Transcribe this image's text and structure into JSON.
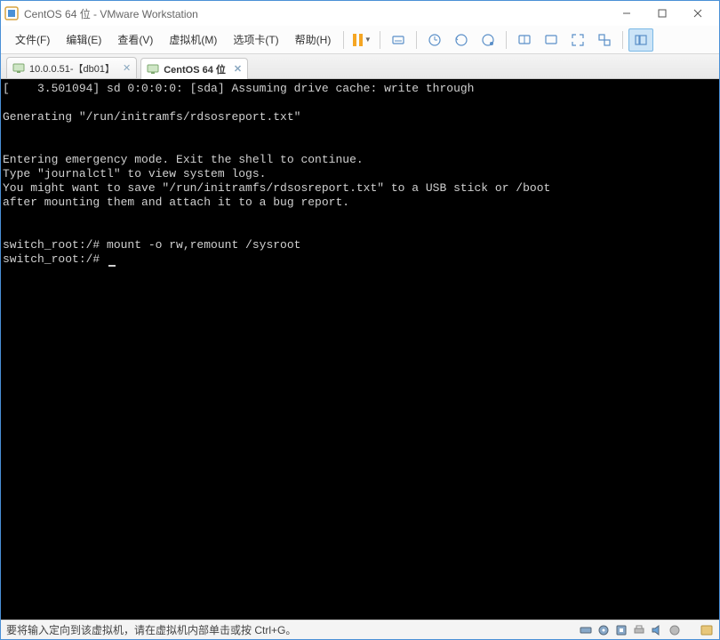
{
  "window": {
    "title": "CentOS 64 位 - VMware Workstation"
  },
  "menu": {
    "file": "文件(F)",
    "edit": "编辑(E)",
    "view": "查看(V)",
    "vm": "虚拟机(M)",
    "tabs": "选项卡(T)",
    "help": "帮助(H)"
  },
  "tabs": {
    "items": [
      {
        "label": "10.0.0.51-【db01】"
      },
      {
        "label": "CentOS 64 位"
      }
    ]
  },
  "terminal": {
    "line1": "[    3.501094] sd 0:0:0:0: [sda] Assuming drive cache: write through",
    "line2": "",
    "line3": "Generating \"/run/initramfs/rdsosreport.txt\"",
    "line4": "",
    "line5": "",
    "line6": "Entering emergency mode. Exit the shell to continue.",
    "line7": "Type \"journalctl\" to view system logs.",
    "line8": "You might want to save \"/run/initramfs/rdsosreport.txt\" to a USB stick or /boot",
    "line9": "after mounting them and attach it to a bug report.",
    "line10": "",
    "line11": "",
    "line12": "switch_root:/# mount -o rw,remount /sysroot",
    "line13": "switch_root:/# "
  },
  "status": {
    "text": "要将输入定向到该虚拟机，请在虚拟机内部单击或按 Ctrl+G。"
  }
}
